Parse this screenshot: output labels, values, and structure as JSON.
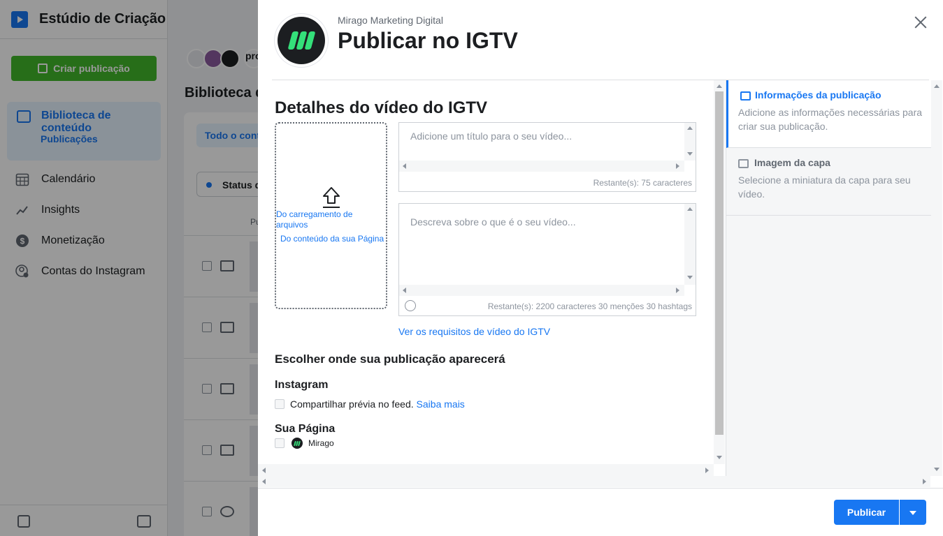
{
  "app": {
    "title": "Estúdio de Criação",
    "create_button": "Criar publicação",
    "nav_active": {
      "label": "Biblioteca de conteúdo",
      "sub": "Publicações"
    },
    "nav": [
      {
        "label": "Calendário",
        "icon": "calendar-icon"
      },
      {
        "label": "Insights",
        "icon": "insights-icon"
      },
      {
        "label": "Monetização",
        "icon": "dollar-icon"
      },
      {
        "label": "Contas do Instagram",
        "icon": "instagram-accounts-icon"
      }
    ],
    "main": {
      "account_label": "pro",
      "heading": "Biblioteca d",
      "tab": "Todo o conte",
      "filter": "Status d",
      "column": "Pu"
    }
  },
  "dialog": {
    "page_name": "Mirago Marketing Digital",
    "title": "Publicar no IGTV",
    "section_title": "Detalhes do vídeo do IGTV",
    "upload": {
      "from_files": "Do carregamento de arquivos",
      "from_page": "Do conteúdo da sua Página"
    },
    "title_field": {
      "placeholder": "Adicione um título para o seu vídeo...",
      "counter": "Restante(s): 75 caracteres"
    },
    "description_field": {
      "placeholder": "Descreva sobre o que é o seu vídeo...",
      "counter": "Restante(s): 2200 caracteres 30 menções 30 hashtags"
    },
    "requirements_link": "Ver os requisitos de vídeo do IGTV",
    "placement_title": "Escolher onde sua publicação aparecerá",
    "instagram": {
      "title": "Instagram",
      "share_label": "Compartilhar prévia no feed.",
      "learn_more": "Saiba mais"
    },
    "your_page": {
      "title": "Sua Página",
      "page": "Mirago"
    },
    "steps": [
      {
        "title": "Informações da publicação",
        "desc": "Adicione as informações necessárias para criar sua publicação.",
        "icon": "post-info-icon"
      },
      {
        "title": "Imagem da capa",
        "desc": "Selecione a miniatura da capa para seu vídeo.",
        "icon": "image-icon"
      }
    ],
    "publish_button": "Publicar"
  },
  "colors": {
    "accent": "#1877f2",
    "create": "#42b72a",
    "logo_green": "#34e07a"
  }
}
